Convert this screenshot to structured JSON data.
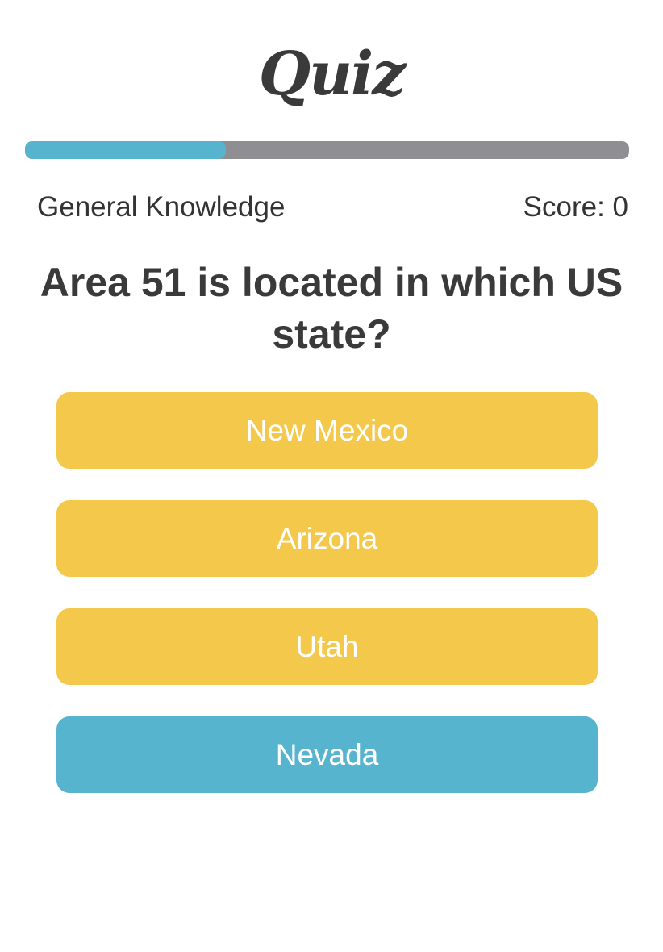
{
  "header": {
    "title": "Quiz"
  },
  "progress": {
    "fraction": 0.333
  },
  "info": {
    "category": "General Knowledge",
    "score_label": "Score: 0"
  },
  "question": {
    "text": "Area 51 is located in which US state?"
  },
  "answers": [
    {
      "label": "New Mexico",
      "color": "#f4c94b"
    },
    {
      "label": "Arizona",
      "color": "#f4c94b"
    },
    {
      "label": "Utah",
      "color": "#f4c94b"
    },
    {
      "label": "Nevada",
      "color": "#57b4cf"
    }
  ],
  "colors": {
    "accent_blue": "#57b4cf",
    "answer_yellow": "#f4c94b",
    "track_gray": "#8e8e93",
    "text_dark": "#3a3a3a"
  }
}
